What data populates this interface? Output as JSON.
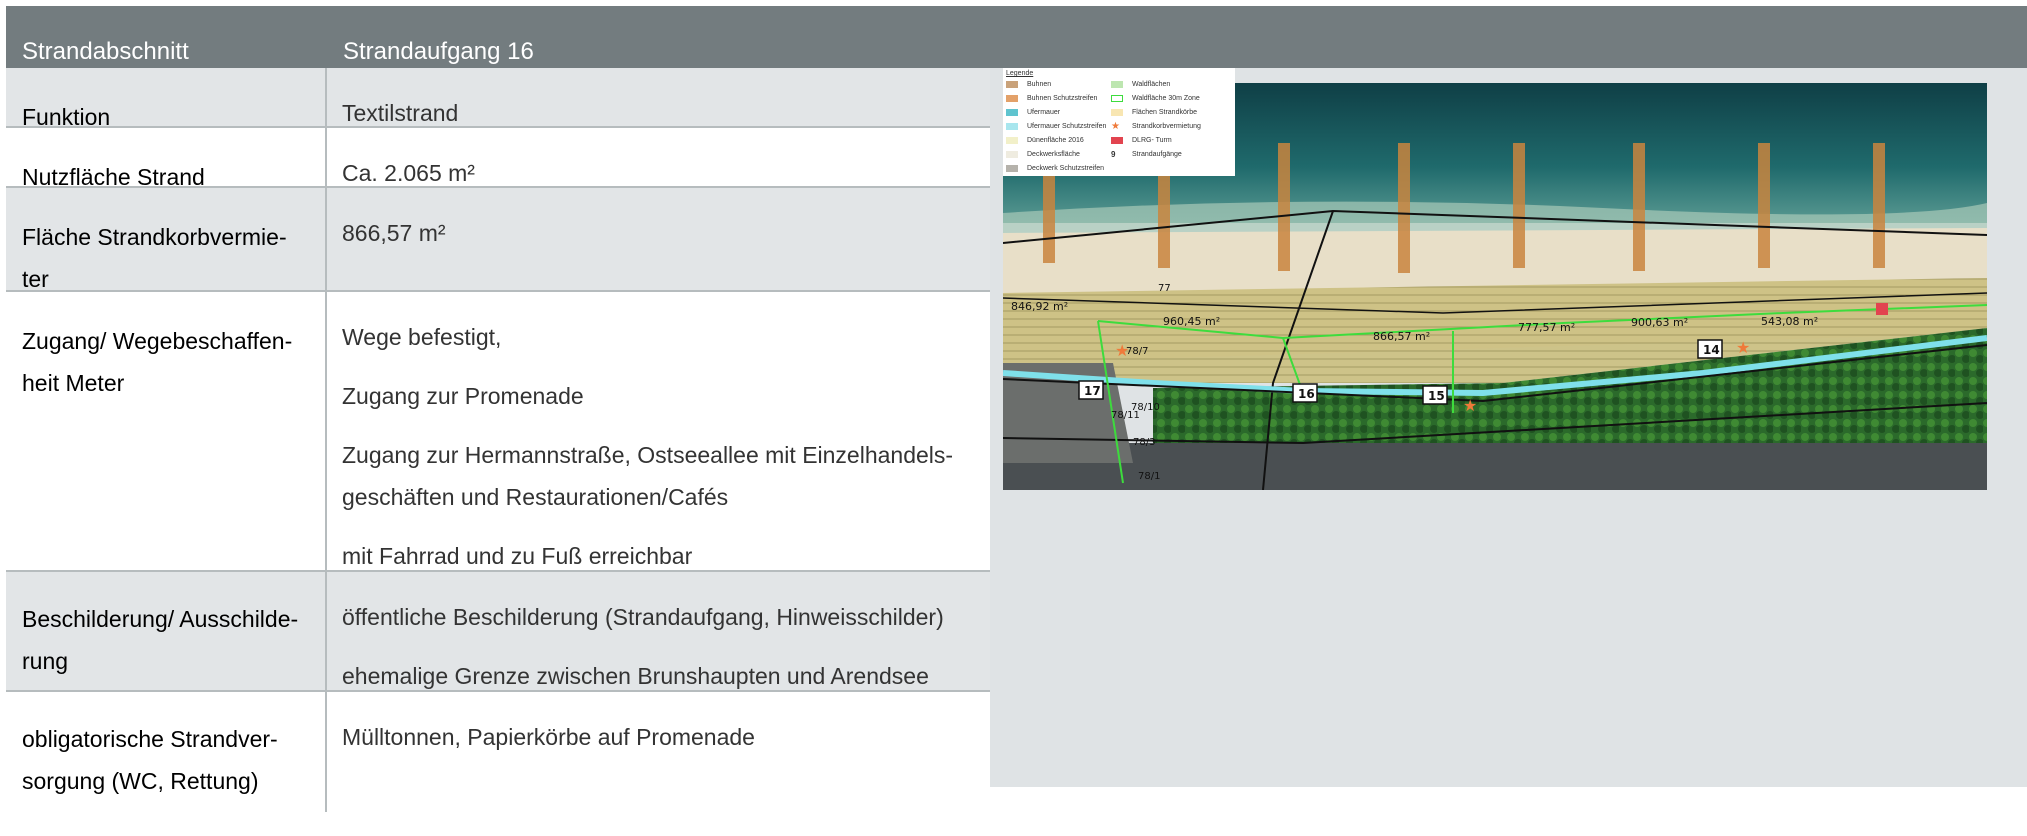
{
  "header": {
    "col1": "Strandabschnitt",
    "col2": "Strandaufgang 16"
  },
  "rows": [
    {
      "label": "Funktion",
      "values": [
        "Textilstrand"
      ]
    },
    {
      "label": "Nutzfläche Strand",
      "values": [
        "Ca. 2.065 m²"
      ]
    },
    {
      "label_lines": [
        "Fläche Strandkorbvermie-",
        "ter"
      ],
      "values": [
        "866,57 m²"
      ]
    },
    {
      "label_lines": [
        "Zugang/ Wegebeschaffen-",
        "heit Meter"
      ],
      "values": [
        "Wege befestigt,",
        "Zugang zur Promenade",
        "Zugang zur Hermannstraße, Ostseeallee mit Einzelhandels-",
        "geschäften und Restaurationen/Cafés",
        "mit Fahrrad und zu Fuß erreichbar"
      ]
    },
    {
      "label_lines": [
        "Beschilderung/ Ausschilde-",
        "rung"
      ],
      "values": [
        "öffentliche Beschilderung (Strandaufgang, Hinweisschilder)",
        "ehemalige Grenze zwischen Brunshaupten und Arendsee"
      ]
    },
    {
      "label_lines": [
        "obligatorische Strandver-",
        "sorgung (WC, Rettung)"
      ],
      "values": [
        "Mülltonnen, Papierkörbe auf Promenade"
      ]
    }
  ],
  "legend": {
    "title": "Legende",
    "items": [
      {
        "label": "Buhnen",
        "color": "#c9a27a"
      },
      {
        "label": "Buhnen Schutzstreifen",
        "color": "#e3a169"
      },
      {
        "label": "Ufermauer",
        "color": "#5fc4cf"
      },
      {
        "label": "Ufermauer Schutzstreifen",
        "color": "#a8e6ee"
      },
      {
        "label": "Dünenfläche 2016",
        "color": "#f2f0c9"
      },
      {
        "label": "Deckwerksfläche",
        "color": "#efece0"
      },
      {
        "label": "Deckwerk Schutzstreifen",
        "color": "#b5b2ab"
      },
      {
        "label": "Waldflächen",
        "color": "#bde6b0"
      },
      {
        "label": "Waldfläche 30m Zone",
        "color": "#ffffff"
      },
      {
        "label": "Flächen Strandkörbe",
        "color": "#f8e6b2"
      },
      {
        "label": "Strandkorbvermietung",
        "color": "#ef7a3a"
      },
      {
        "label": "DLRG- Turm",
        "color": "#e2444f"
      },
      {
        "label": "Strandaufgänge",
        "color": "#000000"
      }
    ],
    "strandaufgang_symbol": "9"
  },
  "map_labels": {
    "areas": [
      "846,92 m²",
      "960,45 m²",
      "866,57 m²",
      "777,57 m²",
      "900,63 m²",
      "543,08 m²"
    ],
    "parcels": [
      "77",
      "78/7",
      "78/10",
      "78/11",
      "78/3",
      "78/1"
    ],
    "entrances": [
      "17",
      "16",
      "15",
      "14"
    ]
  }
}
